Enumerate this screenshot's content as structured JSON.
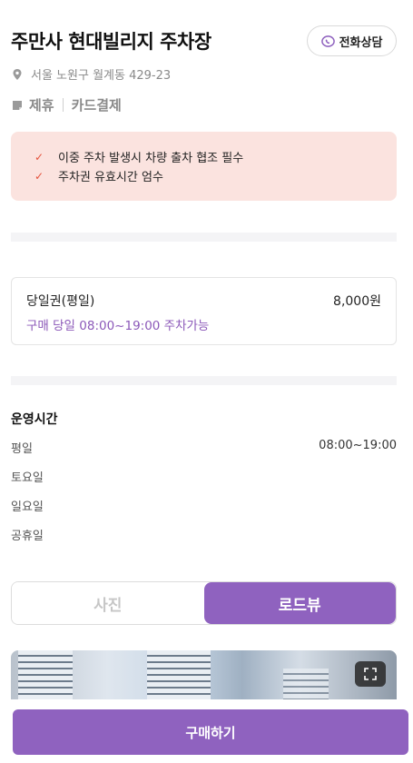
{
  "header": {
    "title": "주만사 현대빌리지 주차장",
    "call_label": "전화상담"
  },
  "address": {
    "text": "서울 노원구 월계동 429-23"
  },
  "tags": [
    "제휴",
    "카드결제"
  ],
  "notice": {
    "items": [
      "이중 주차 발생시 차량 출차 협조 필수",
      "주차권 유효시간 엄수"
    ]
  },
  "ticket": {
    "name": "당일권(평일)",
    "price": "8,000원",
    "desc": "구매 당일 08:00~19:00 주차가능"
  },
  "hours": {
    "title": "운영시간",
    "rows": [
      {
        "day": "평일",
        "time": "08:00~19:00"
      },
      {
        "day": "토요일",
        "time": ""
      },
      {
        "day": "일요일",
        "time": ""
      },
      {
        "day": "공휴일",
        "time": ""
      }
    ]
  },
  "view_toggle": {
    "photo": "사진",
    "roadview": "로드뷰",
    "selected": "로드뷰"
  },
  "purchase": {
    "label": "구매하기"
  },
  "colors": {
    "accent": "#8f62bf",
    "notice_bg": "#fbe3df",
    "check": "#e5533d"
  },
  "icons": [
    "chat-phone-icon",
    "location-pin-icon",
    "tag-icon",
    "check-icon",
    "expand-icon"
  ]
}
